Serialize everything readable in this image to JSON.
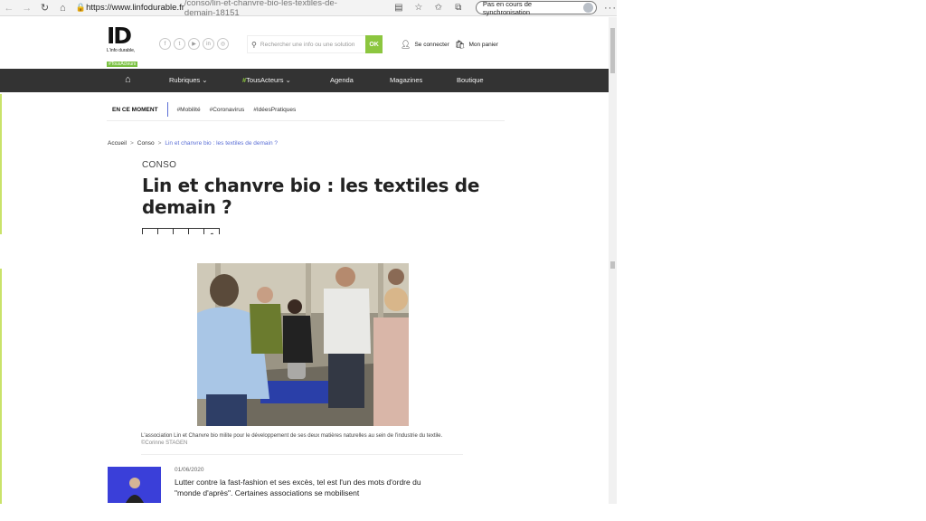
{
  "browser": {
    "url_host": "https://www.linfodurable.fr",
    "url_path": "/conso/lin-et-chanvre-bio-les-textiles-de-demain-18151",
    "sync_label": "Pas en cours de synchronisation",
    "icons": [
      "back-icon",
      "forward-icon",
      "refresh-icon",
      "home-icon",
      "lock-icon",
      "reading-view-icon",
      "favorite-star-icon",
      "favorites-bar-icon",
      "collections-icon",
      "more-icon"
    ]
  },
  "header": {
    "logo_text": "ID",
    "logo_tag1": "L'info durable,",
    "logo_tag2": "#TousActeurs",
    "social_icons": [
      "facebook-icon",
      "twitter-icon",
      "youtube-icon",
      "linkedin-icon",
      "instagram-icon"
    ],
    "search_placeholder": "Rechercher une info ou une solution",
    "search_button": "OK",
    "login_label": "Se connecter",
    "cart_label": "Mon panier"
  },
  "nav": {
    "items": [
      {
        "label": "Rubriques ⌄"
      },
      {
        "hash": "#",
        "label": "TousActeurs ⌄"
      },
      {
        "label": "Agenda"
      },
      {
        "label": "Magazines"
      },
      {
        "label": "Boutique"
      }
    ]
  },
  "moment": {
    "label": "EN CE MOMENT",
    "tags": [
      "#Mobilité",
      "#Coronavirus",
      "#IdéesPratiques"
    ]
  },
  "breadcrumb": {
    "home": "Accueil",
    "section": "Conso",
    "current": "Lin et chanvre bio : les textiles de demain ?"
  },
  "article": {
    "rubrique": "CONSO",
    "title": "Lin et chanvre bio : les textiles de demain ?",
    "share": [
      "f",
      "t",
      "in",
      "✉",
      "⎙"
    ],
    "caption": "L'association Lin et Chanvre bio milite pour le développement de ses deux matières naturelles au sein de l'industrie du textile.",
    "credit": "©Corinne STAGEN",
    "date": "01/06/2020",
    "lead": "Lutter contre la fast-fashion et ses excès, tel est l'un des mots d'ordre du \"monde d'après\". Certaines associations se mobilisent"
  }
}
